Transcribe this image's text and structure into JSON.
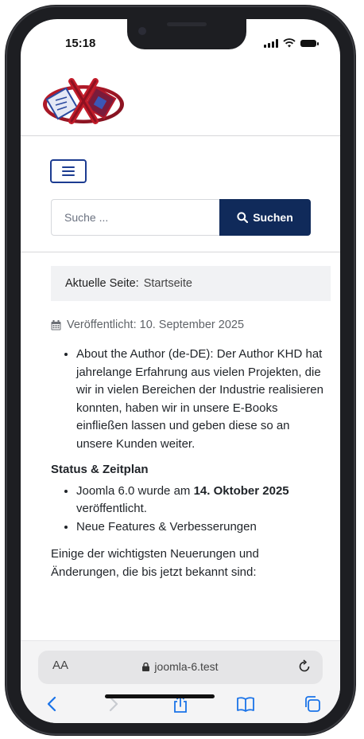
{
  "status_bar": {
    "time": "15:18"
  },
  "header": {
    "logo_alt": "Site logo",
    "menu_icon": "hamburger-icon"
  },
  "search": {
    "placeholder": "Suche ...",
    "button_label": "Suchen"
  },
  "breadcrumb": {
    "label": "Aktuelle Seite:",
    "current": "Startseite"
  },
  "article": {
    "published": "Veröffentlicht: 10. September 2025",
    "bullet_author": "About the Author (de-DE): Der Author KHD hat jahrelange Erfahrung aus vielen Projekten, die wir in vielen Bereichen der Industrie realisieren konnten, haben wir in unsere E-Books einfließen lassen und geben diese so an unsere Kunden weiter.",
    "status_heading": "Status & Zeitplan",
    "release_prefix": "Joomla 6.0 wurde am ",
    "release_date": "14. Oktober 2025",
    "release_suffix": " veröffentlicht.",
    "features": "Neue Features & Verbesserungen",
    "intro": "Einige der wichtigsten Neuerungen und Änderungen, die bis jetzt bekannt sind:"
  },
  "browser": {
    "text_size": "AA",
    "url": "joomla-6.test",
    "accent": "#1a73e8"
  }
}
